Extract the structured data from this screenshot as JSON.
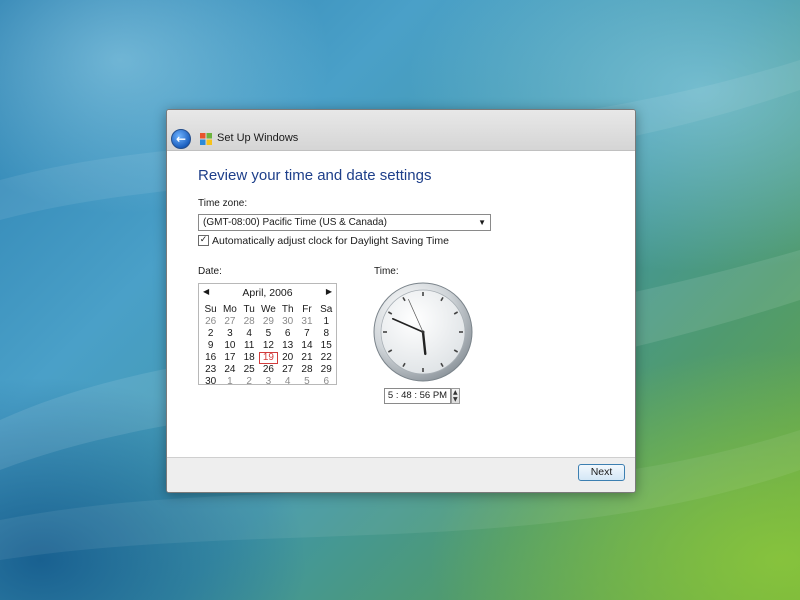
{
  "window": {
    "title": "Set Up Windows",
    "heading": "Review your time and date settings"
  },
  "timezone": {
    "label": "Time zone:",
    "selected": "(GMT-08:00) Pacific Time (US & Canada)",
    "dst_checked": true,
    "dst_label": "Automatically adjust clock for Daylight Saving Time"
  },
  "date": {
    "label": "Date:",
    "month_title": "April, 2006",
    "weekdays": [
      "Su",
      "Mo",
      "Tu",
      "We",
      "Th",
      "Fr",
      "Sa"
    ],
    "weeks": [
      [
        "26",
        "27",
        "28",
        "29",
        "30",
        "31",
        "1"
      ],
      [
        "2",
        "3",
        "4",
        "5",
        "6",
        "7",
        "8"
      ],
      [
        "9",
        "10",
        "11",
        "12",
        "13",
        "14",
        "15"
      ],
      [
        "16",
        "17",
        "18",
        "19",
        "20",
        "21",
        "22"
      ],
      [
        "23",
        "24",
        "25",
        "26",
        "27",
        "28",
        "29"
      ],
      [
        "30",
        "1",
        "2",
        "3",
        "4",
        "5",
        "6"
      ]
    ],
    "selected_day": "19"
  },
  "time": {
    "label": "Time:",
    "value": "5 : 48 : 56 PM",
    "hour": 5,
    "minute": 48,
    "second": 56
  },
  "footer": {
    "next_label": "Next"
  },
  "icons": {
    "back": "back-arrow-icon",
    "windows_logo": "windows-logo-icon",
    "dropdown": "chevron-down-icon",
    "prev_month": "chevron-left-icon",
    "next_month": "chevron-right-icon"
  }
}
